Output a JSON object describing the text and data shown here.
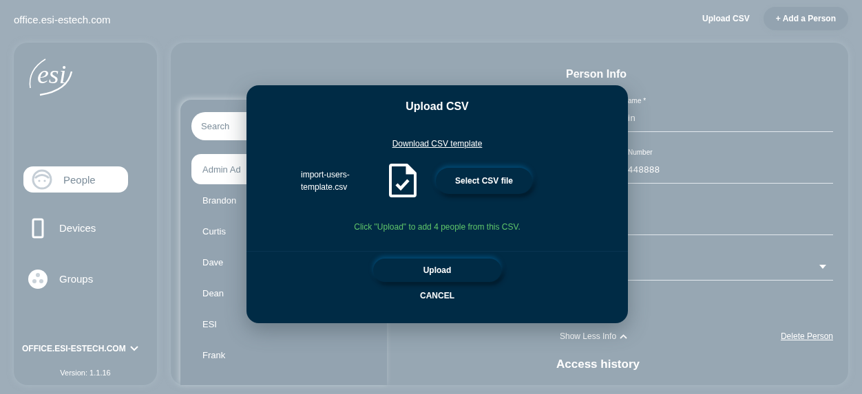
{
  "header": {
    "host": "office.esi-estech.com",
    "upload_link": "Upload CSV",
    "add_button": "+ Add a Person"
  },
  "sidebar": {
    "logo": "esi",
    "items": [
      {
        "label": "People",
        "selected": true
      },
      {
        "label": "Devices",
        "selected": false
      },
      {
        "label": "Groups",
        "selected": false
      }
    ],
    "account": "OFFICE.ESI-ESTECH.COM",
    "version": "Version: 1.1.16"
  },
  "people_list": {
    "search_placeholder": "Search",
    "items": [
      {
        "name": "Admin Ad",
        "selected": true
      },
      {
        "name": "Brandon",
        "selected": false
      },
      {
        "name": "Curtis",
        "selected": false
      },
      {
        "name": "Dave",
        "selected": false
      },
      {
        "name": "Dean",
        "selected": false
      },
      {
        "name": "ESI",
        "selected": false
      },
      {
        "name": "Frank",
        "selected": false
      }
    ]
  },
  "person_info": {
    "title": "Person Info",
    "fields": [
      {
        "kind": "text",
        "label": "ame *",
        "value": "in"
      },
      {
        "kind": "text",
        "label": "Number",
        "value": "448888"
      },
      {
        "kind": "text"
      },
      {
        "kind": "select"
      }
    ],
    "toggle": "Show Less Info",
    "delete_link": "Delete Person",
    "history_title": "Access history"
  },
  "dialog": {
    "title": "Upload CSV",
    "template_link": "Download CSV template",
    "file_name": "import-users-template.csv",
    "select_button": "Select CSV file",
    "message": "Click \"Upload\" to add 4 people from this CSV.",
    "upload_button": "Upload",
    "cancel_button": "CANCEL"
  }
}
